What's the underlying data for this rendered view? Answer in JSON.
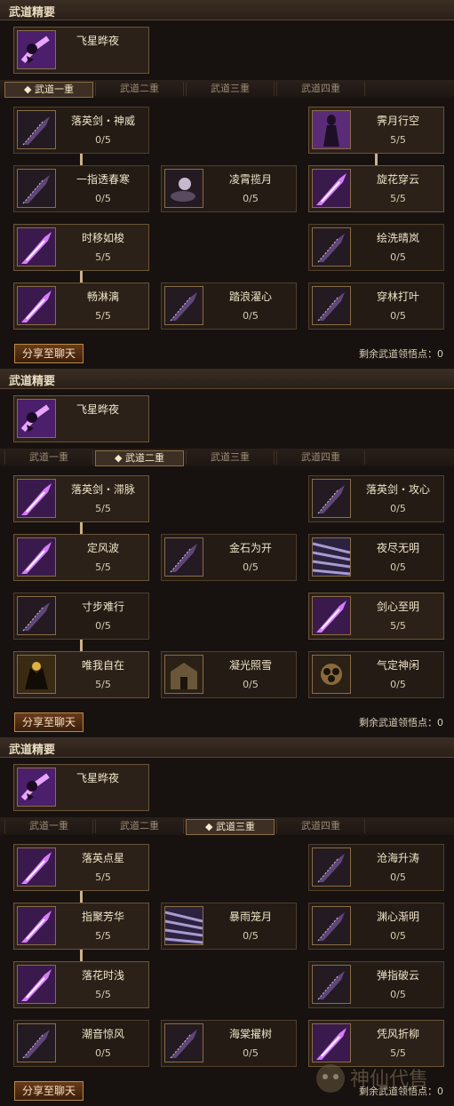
{
  "colors": {
    "accent": "#b88a4a",
    "frame": "#6b5538",
    "bg": "#17110f"
  },
  "panels": [
    {
      "title": "武道精要",
      "essence": {
        "name": "飞星晔夜",
        "icon": "purple-dash-icon"
      },
      "tabs": [
        "武道一重",
        "武道二重",
        "武道三重",
        "武道四重"
      ],
      "active_tab": 0,
      "tab_marker": "◆",
      "skills": [
        {
          "name": "落英剑・神威",
          "level": "0/5",
          "icon": "sword-icon",
          "active": false
        },
        {
          "name": "霁月行空",
          "level": "5/5",
          "icon": "shadow-figure-icon",
          "active": true
        },
        {
          "name": "一指透春寒",
          "level": "0/5",
          "icon": "sword-icon",
          "active": false
        },
        {
          "name": "凌霄揽月",
          "level": "0/5",
          "icon": "moon-cloud-icon",
          "active": false
        },
        {
          "name": "旋花穿云",
          "level": "5/5",
          "icon": "flame-blade-icon",
          "active": true
        },
        {
          "name": "时移如梭",
          "level": "5/5",
          "icon": "flame-blade-icon",
          "active": true
        },
        {
          "name": "绘洗晴岚",
          "level": "0/5",
          "icon": "sword-icon",
          "active": false
        },
        {
          "name": "畅淋漓",
          "level": "5/5",
          "icon": "flame-blade-icon",
          "active": true
        },
        {
          "name": "踏浪濯心",
          "level": "0/5",
          "icon": "sword-icon",
          "active": false
        },
        {
          "name": "穿林打叶",
          "level": "0/5",
          "icon": "sword-icon",
          "active": false
        }
      ],
      "share_label": "分享至聊天",
      "points_label": "剩余武道领悟点：0"
    },
    {
      "title": "武道精要",
      "essence": {
        "name": "飞星晔夜",
        "icon": "purple-dash-icon"
      },
      "tabs": [
        "武道一重",
        "武道二重",
        "武道三重",
        "武道四重"
      ],
      "active_tab": 1,
      "tab_marker": "◆",
      "skills": [
        {
          "name": "落英剑・滞脉",
          "level": "5/5",
          "icon": "flame-blade-icon",
          "active": true
        },
        {
          "name": "落英剑・攻心",
          "level": "0/5",
          "icon": "sword-icon",
          "active": false
        },
        {
          "name": "定风波",
          "level": "5/5",
          "icon": "flame-blade-icon",
          "active": true
        },
        {
          "name": "金石为开",
          "level": "0/5",
          "icon": "sword-icon",
          "active": false
        },
        {
          "name": "夜尽无明",
          "level": "0/5",
          "icon": "light-rays-icon",
          "active": false
        },
        {
          "name": "寸步难行",
          "level": "0/5",
          "icon": "sword-icon",
          "active": false
        },
        {
          "name": "剑心至明",
          "level": "5/5",
          "icon": "flame-blade-icon",
          "active": true
        },
        {
          "name": "唯我自在",
          "level": "5/5",
          "icon": "demon-figure-icon",
          "active": true
        },
        {
          "name": "凝光照雪",
          "level": "0/5",
          "icon": "temple-icon",
          "active": false
        },
        {
          "name": "气定神闲",
          "level": "0/5",
          "icon": "lotus-icon",
          "active": false
        }
      ],
      "share_label": "分享至聊天",
      "points_label": "剩余武道领悟点：0"
    },
    {
      "title": "武道精要",
      "essence": {
        "name": "飞星晔夜",
        "icon": "purple-dash-icon"
      },
      "tabs": [
        "武道一重",
        "武道二重",
        "武道三重",
        "武道四重"
      ],
      "active_tab": 2,
      "tab_marker": "◆",
      "skills": [
        {
          "name": "落英点星",
          "level": "5/5",
          "icon": "flame-blade-icon",
          "active": true
        },
        {
          "name": "沧海升涛",
          "level": "0/5",
          "icon": "sword-icon",
          "active": false
        },
        {
          "name": "指聚芳华",
          "level": "5/5",
          "icon": "flame-blade-icon",
          "active": true
        },
        {
          "name": "暴雨笼月",
          "level": "0/5",
          "icon": "light-rays-icon",
          "active": false
        },
        {
          "name": "渊心渐明",
          "level": "0/5",
          "icon": "sword-icon",
          "active": false
        },
        {
          "name": "落花时浅",
          "level": "5/5",
          "icon": "flame-blade-icon",
          "active": true
        },
        {
          "name": "弹指破云",
          "level": "0/5",
          "icon": "sword-icon",
          "active": false
        },
        {
          "name": "潮音惊风",
          "level": "0/5",
          "icon": "sword-icon",
          "active": false
        },
        {
          "name": "海棠擢树",
          "level": "0/5",
          "icon": "sword-icon",
          "active": false
        },
        {
          "name": "凭风折柳",
          "level": "5/5",
          "icon": "flame-blade-icon",
          "active": true
        }
      ],
      "share_label": "分享至聊天",
      "points_label": "剩余武道领悟点：0"
    }
  ],
  "watermark": "神仙代售"
}
